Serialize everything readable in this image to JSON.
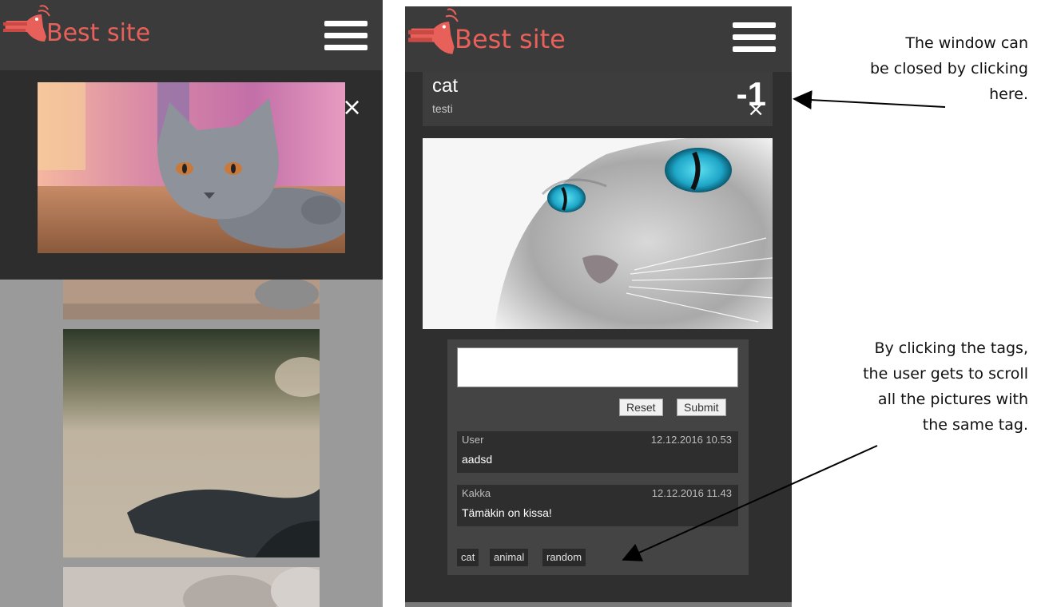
{
  "app": {
    "logo_text": "Best site"
  },
  "icons": {
    "logo": "shrimp-logo-icon",
    "menu": "hamburger-menu-icon",
    "close": "close-icon"
  },
  "colors": {
    "brand": "#e8605a",
    "header": "#3b3b3b",
    "panel": "#2f2f2f"
  },
  "left_view": {
    "close_symbol": "×"
  },
  "right_view": {
    "post": {
      "title": "cat",
      "subtitle": "testi",
      "score": "-1"
    },
    "close_symbol": "×",
    "comment_form": {
      "input_value": "",
      "reset_label": "Reset",
      "submit_label": "Submit"
    },
    "comments": [
      {
        "user": "User",
        "date": "12.12.2016 10.53",
        "text": "aadsd"
      },
      {
        "user": "Kakka",
        "date": "12.12.2016 11.43",
        "text": "Tämäkin on kissa!"
      }
    ],
    "tags": [
      "cat",
      "animal",
      "random"
    ]
  },
  "annotations": {
    "close_note": [
      "The window can",
      "be closed by clicking",
      "here."
    ],
    "tags_note": [
      "By clicking the tags,",
      "the user gets to scroll",
      "all the pictures with",
      "the same tag."
    ]
  }
}
